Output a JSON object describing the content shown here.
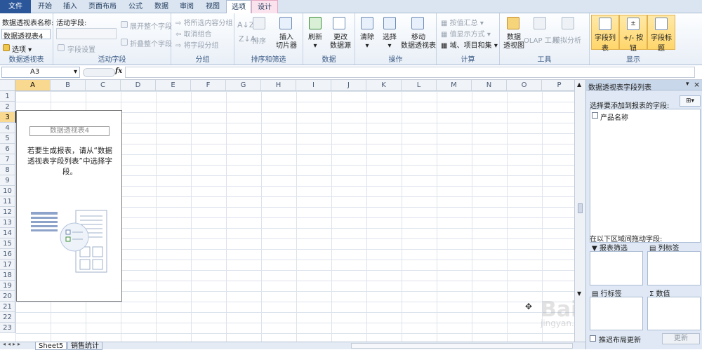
{
  "tabs": [
    {
      "label": "文件",
      "style": "file"
    },
    {
      "label": "开始",
      "style": ""
    },
    {
      "label": "插入",
      "style": ""
    },
    {
      "label": "页面布局",
      "style": ""
    },
    {
      "label": "公式",
      "style": ""
    },
    {
      "label": "数据",
      "style": ""
    },
    {
      "label": "审阅",
      "style": ""
    },
    {
      "label": "视图",
      "style": ""
    },
    {
      "label": "选项",
      "style": "active"
    },
    {
      "label": "设计",
      "style": "hl"
    }
  ],
  "ribbon": {
    "pivot_name_label": "数据透视表名称:",
    "pivot_name_value": "数据透视表4",
    "options_btn": "选项",
    "group_pivot": "数据透视表",
    "active_field_label": "活动字段:",
    "field_settings": "字段设置",
    "expand_field": "展开整个字段",
    "collapse_field": "折叠整个字段",
    "group_active_field": "活动字段",
    "group_selection": "将所选内容分组",
    "ungroup": "取消组合",
    "group_field": "将字段分组",
    "group_group": "分组",
    "sort": "排序",
    "insert_slicer": [
      "插入",
      "切片器"
    ],
    "group_sort_filter": "排序和筛选",
    "refresh": "刷新",
    "change_source": [
      "更改",
      "数据源"
    ],
    "group_data": "数据",
    "clear": "清除",
    "select": "选择",
    "move_pivot": [
      "移动",
      "数据透视表"
    ],
    "group_actions": "操作",
    "summarize_by": "按值汇总",
    "show_values_as": "值显示方式",
    "fields_items_sets": "域、项目和集",
    "group_calc": "计算",
    "pivot_chart": [
      "数据",
      "透视图"
    ],
    "olap_tools": "OLAP 工具",
    "what_if": "模拟分析",
    "group_tools": "工具",
    "field_list": "字段列表",
    "buttons": "+/- 按钮",
    "field_headers": "字段标题",
    "group_show": "显示"
  },
  "formula_bar": {
    "name_box": "A3",
    "fx": "fx",
    "formula": ""
  },
  "columns": [
    "A",
    "B",
    "C",
    "D",
    "E",
    "F",
    "G",
    "H",
    "I",
    "J",
    "K",
    "L",
    "M",
    "N",
    "O",
    "P"
  ],
  "rows": [
    "1",
    "2",
    "3",
    "4",
    "5",
    "6",
    "7",
    "8",
    "9",
    "10",
    "11",
    "12",
    "13",
    "14",
    "15",
    "16",
    "17",
    "18",
    "19",
    "20",
    "21",
    "22",
    "23"
  ],
  "selected_col": "A",
  "selected_row": "3",
  "placeholder": {
    "title": "数据透视表4",
    "message": [
      "若要生成报表，请从“数据",
      "透视表字段列表”中选择字",
      "段。"
    ]
  },
  "panel": {
    "title": "数据透视表字段列表",
    "choose_fields": "选择要添加到报表的字段:",
    "fields": [
      "产品名称"
    ],
    "drag_between": "在以下区域间拖动字段:",
    "report_filter": "报表筛选",
    "column_labels": "列标签",
    "row_labels": "行标签",
    "values": "数值",
    "defer_update": "推迟布局更新",
    "update_btn": "更新"
  },
  "sheet_tabs": [
    "Sheet5",
    "销售统计"
  ],
  "watermark": {
    "brand": "Baidu 经验",
    "url": "jingyan.baidu.com"
  },
  "colors": {
    "accent": "#2b579a",
    "selected": "#f9d98f",
    "highlight_btn": "#ffd66b"
  }
}
